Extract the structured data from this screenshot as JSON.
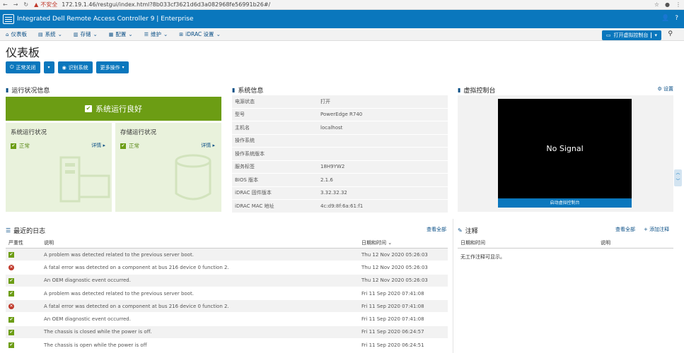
{
  "browser": {
    "insecure": "不安全",
    "url": "172.19.1.46/restgui/index.html?8b033cf3621d6d3a082968fe56991b26#/"
  },
  "header": {
    "title": "Integrated Dell Remote Access Controller 9 | Enterprise"
  },
  "menu": {
    "items": [
      {
        "label": "仪表板",
        "icon": "home-icon"
      },
      {
        "label": "系统",
        "icon": "server-icon"
      },
      {
        "label": "存储",
        "icon": "storage-icon"
      },
      {
        "label": "配置",
        "icon": "config-icon"
      },
      {
        "label": "维护",
        "icon": "maintenance-icon"
      },
      {
        "label": "iDRAC 设置",
        "icon": "network-icon"
      }
    ],
    "virtual_console_button": "打开虚拟控制台"
  },
  "page": {
    "title": "仪表板"
  },
  "actions": {
    "graceful_shutdown": "正常关闭",
    "identify": "识别系统",
    "more": "更多操作"
  },
  "health": {
    "section_title": "运行状况信息",
    "banner": "系统运行良好",
    "system_title": "系统运行状况",
    "system_status": "正常",
    "storage_title": "存储运行状况",
    "storage_status": "正常",
    "details": "详情"
  },
  "sysinfo": {
    "section_title": "系统信息",
    "rows": [
      {
        "label": "电源状态",
        "value": "打开"
      },
      {
        "label": "型号",
        "value": "PowerEdge R740"
      },
      {
        "label": "主机名",
        "value": "localhost"
      },
      {
        "label": "操作系统",
        "value": ""
      },
      {
        "label": "操作系统版本",
        "value": ""
      },
      {
        "label": "服务标签",
        "value": "18H9YW2"
      },
      {
        "label": "BIOS 版本",
        "value": "2.1.6"
      },
      {
        "label": "iDRAC 固件版本",
        "value": "3.32.32.32"
      },
      {
        "label": "iDRAC MAC 地址",
        "value": "4c:d9:8f:6a:61:f1"
      }
    ]
  },
  "vconsole": {
    "section_title": "虚拟控制台",
    "settings": "设置",
    "screen_text": "No Signal",
    "launch": "启动虚拟控制台"
  },
  "logs": {
    "section_title": "最近的日志",
    "view_all": "查看全部",
    "headers": {
      "severity": "严重性",
      "description": "说明",
      "datetime": "日期和时间"
    },
    "rows": [
      {
        "severity": "ok",
        "description": "A problem was detected related to the previous server boot.",
        "datetime": "Thu 12 Nov 2020 05:26:03"
      },
      {
        "severity": "error",
        "description": "A fatal error was detected on a component at bus 216 device 0 function 2.",
        "datetime": "Thu 12 Nov 2020 05:26:03"
      },
      {
        "severity": "ok",
        "description": "An OEM diagnostic event occurred.",
        "datetime": "Thu 12 Nov 2020 05:26:03"
      },
      {
        "severity": "ok",
        "description": "A problem was detected related to the previous server boot.",
        "datetime": "Fri 11 Sep 2020 07:41:08"
      },
      {
        "severity": "error",
        "description": "A fatal error was detected on a component at bus 216 device 0 function 2.",
        "datetime": "Fri 11 Sep 2020 07:41:08"
      },
      {
        "severity": "ok",
        "description": "An OEM diagnostic event occurred.",
        "datetime": "Fri 11 Sep 2020 07:41:08"
      },
      {
        "severity": "ok",
        "description": "The chassis is closed while the power is off.",
        "datetime": "Fri 11 Sep 2020 06:24:57"
      },
      {
        "severity": "ok",
        "description": "The chassis is open while the power is off",
        "datetime": "Fri 11 Sep 2020 06:24:51"
      }
    ]
  },
  "notes": {
    "section_title": "注释",
    "view_all": "查看全部",
    "add": "添加注释",
    "headers": {
      "datetime": "日期和时间",
      "description": "说明"
    },
    "empty": "无工作注释可显示。"
  }
}
